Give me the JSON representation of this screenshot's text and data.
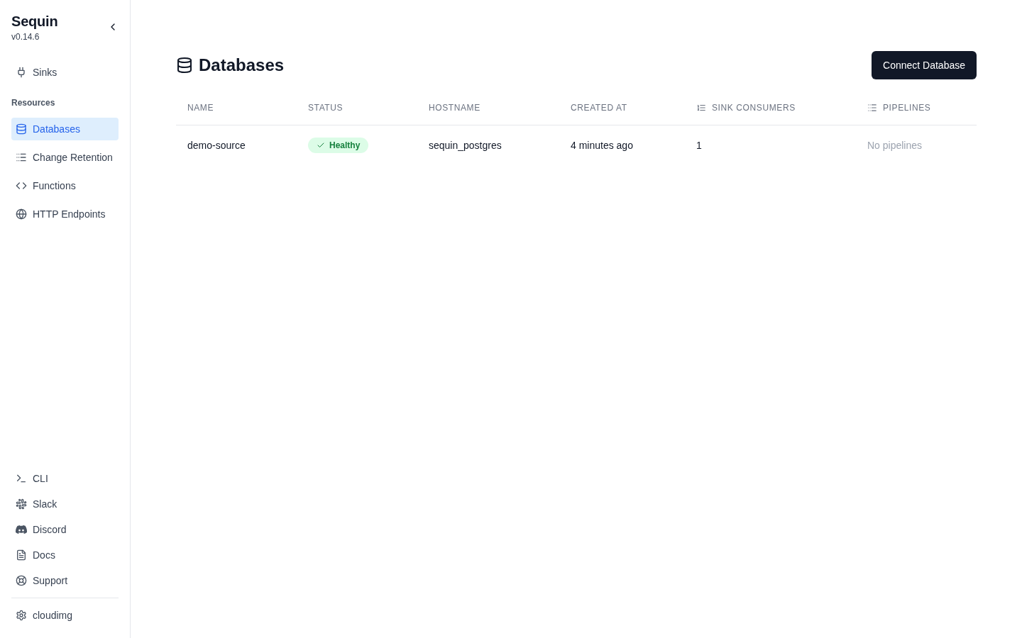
{
  "sidebar": {
    "app_name": "Sequin",
    "version": "v0.14.6",
    "nav_items": [
      {
        "label": "Sinks",
        "selected": false
      }
    ],
    "section_label": "Resources",
    "resource_items": [
      {
        "label": "Databases",
        "selected": true
      },
      {
        "label": "Change Retention",
        "selected": false
      },
      {
        "label": "Functions",
        "selected": false
      },
      {
        "label": "HTTP Endpoints",
        "selected": false
      }
    ],
    "footer_links": [
      {
        "label": "CLI"
      },
      {
        "label": "Slack"
      },
      {
        "label": "Discord"
      },
      {
        "label": "Docs"
      },
      {
        "label": "Support"
      }
    ],
    "account": {
      "label": "cloudimg"
    }
  },
  "page": {
    "title": "Databases",
    "primary_button": "Connect Database"
  },
  "table": {
    "columns": [
      {
        "label": "NAME"
      },
      {
        "label": "STATUS"
      },
      {
        "label": "HOSTNAME"
      },
      {
        "label": "CREATED AT"
      },
      {
        "label": "SINK CONSUMERS"
      },
      {
        "label": "PIPELINES"
      }
    ],
    "rows": [
      {
        "name": "demo-source",
        "status": {
          "label": "Healthy",
          "kind": "healthy"
        },
        "hostname": "sequin_postgres",
        "created_at": "4 minutes ago",
        "sink_consumers": "1",
        "pipelines": {
          "text": "No pipelines",
          "empty": true
        }
      }
    ]
  }
}
